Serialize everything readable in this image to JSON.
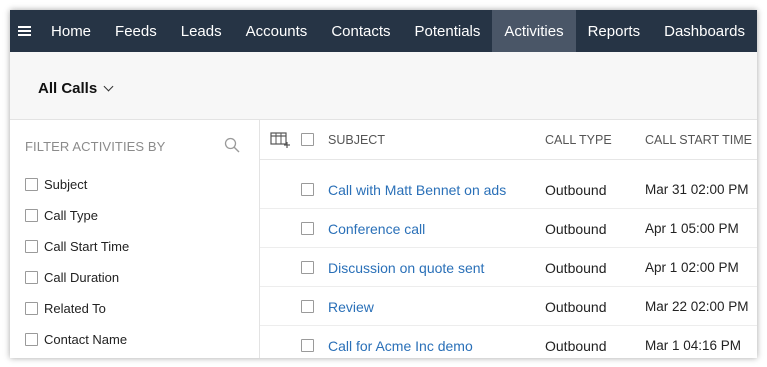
{
  "nav": {
    "items": [
      {
        "label": "Home"
      },
      {
        "label": "Feeds"
      },
      {
        "label": "Leads"
      },
      {
        "label": "Accounts"
      },
      {
        "label": "Contacts"
      },
      {
        "label": "Potentials"
      },
      {
        "label": "Activities"
      },
      {
        "label": "Reports"
      },
      {
        "label": "Dashboards"
      }
    ],
    "active": "Activities"
  },
  "view": {
    "label": "All Calls"
  },
  "filter": {
    "title": "FILTER ACTIVITIES BY",
    "items": [
      {
        "label": "Subject"
      },
      {
        "label": "Call Type"
      },
      {
        "label": "Call Start Time"
      },
      {
        "label": "Call Duration"
      },
      {
        "label": "Related To"
      },
      {
        "label": "Contact Name"
      }
    ]
  },
  "table": {
    "columns": {
      "subject": "SUBJECT",
      "type": "CALL TYPE",
      "start": "CALL START TIME"
    },
    "rows": [
      {
        "subject": "Call with Matt Bennet on ads",
        "type": "Outbound",
        "start": "Mar 31 02:00 PM"
      },
      {
        "subject": "Conference call",
        "type": "Outbound",
        "start": "Apr 1 05:00 PM"
      },
      {
        "subject": "Discussion on quote sent",
        "type": "Outbound",
        "start": "Apr 1 02:00 PM"
      },
      {
        "subject": "Review",
        "type": "Outbound",
        "start": "Mar 22 02:00 PM"
      },
      {
        "subject": "Call for Acme Inc demo",
        "type": "Outbound",
        "start": "Mar 1 04:16 PM"
      }
    ]
  },
  "colors": {
    "nav_bg": "#263445",
    "nav_active": "#4a5667",
    "link": "#2a70b8"
  },
  "icons": {
    "menu": "hamburger-icon",
    "search": "search-icon",
    "columns": "column-settings-icon",
    "dropdown": "chevron-down-icon"
  }
}
